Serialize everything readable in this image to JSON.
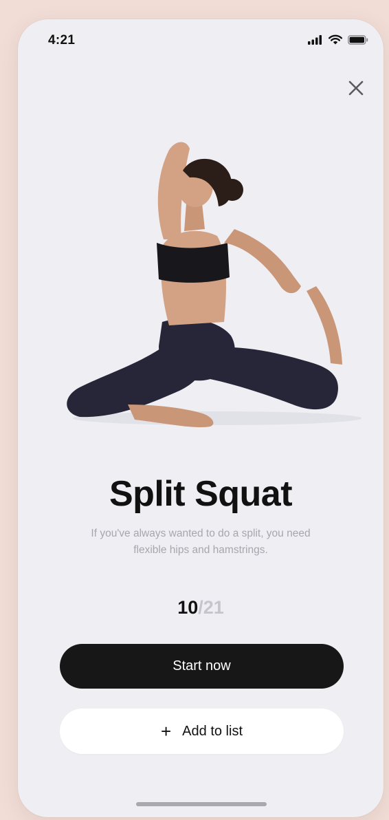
{
  "status_bar": {
    "time": "4:21",
    "icons": [
      "signal-icon",
      "wifi-icon",
      "battery-icon"
    ]
  },
  "header": {
    "close_icon": "close-icon"
  },
  "exercise": {
    "title": "Split Squat",
    "description": "If you've always wanted to do a split, you need flexible hips and hamstrings.",
    "progress_current": "10",
    "progress_total": "/21"
  },
  "actions": {
    "primary_label": "Start now",
    "secondary_icon": "+",
    "secondary_label": "Add to list"
  },
  "colors": {
    "background": "#f1ddd6",
    "screen": "#efeef3",
    "primary_button": "#171717",
    "secondary_button": "#ffffff",
    "muted_text": "#a7a6ad"
  }
}
